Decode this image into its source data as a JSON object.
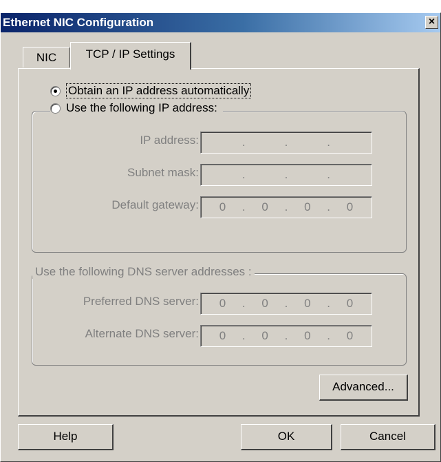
{
  "window": {
    "title": "Ethernet NIC Configuration",
    "close_glyph": "×"
  },
  "tabs": [
    {
      "label": "NIC",
      "active": false
    },
    {
      "label": "TCP / IP Settings",
      "active": true
    }
  ],
  "ip_mode": {
    "auto_label": "Obtain an IP address automatically",
    "manual_label": "Use the following IP address:",
    "selected": "auto"
  },
  "ip_fields": {
    "ip_address": {
      "label": "IP address:",
      "octets": [
        "",
        "",
        "",
        ""
      ]
    },
    "subnet_mask": {
      "label": "Subnet mask:",
      "octets": [
        "",
        "",
        "",
        ""
      ]
    },
    "default_gateway": {
      "label": "Default gateway:",
      "octets": [
        "0",
        "0",
        "0",
        "0"
      ]
    }
  },
  "dns": {
    "legend": "Use the following DNS server addresses :",
    "preferred": {
      "label": "Preferred DNS server:",
      "octets": [
        "0",
        "0",
        "0",
        "0"
      ]
    },
    "alternate": {
      "label": "Alternate DNS server:",
      "octets": [
        "0",
        "0",
        "0",
        "0"
      ]
    }
  },
  "buttons": {
    "advanced": "Advanced...",
    "help": "Help",
    "ok": "OK",
    "cancel": "Cancel"
  },
  "colors": {
    "title_gradient_start": "#0a246a",
    "title_gradient_end": "#a6caf0",
    "dialog_face": "#d4d0c8",
    "disabled_text": "#808080"
  }
}
